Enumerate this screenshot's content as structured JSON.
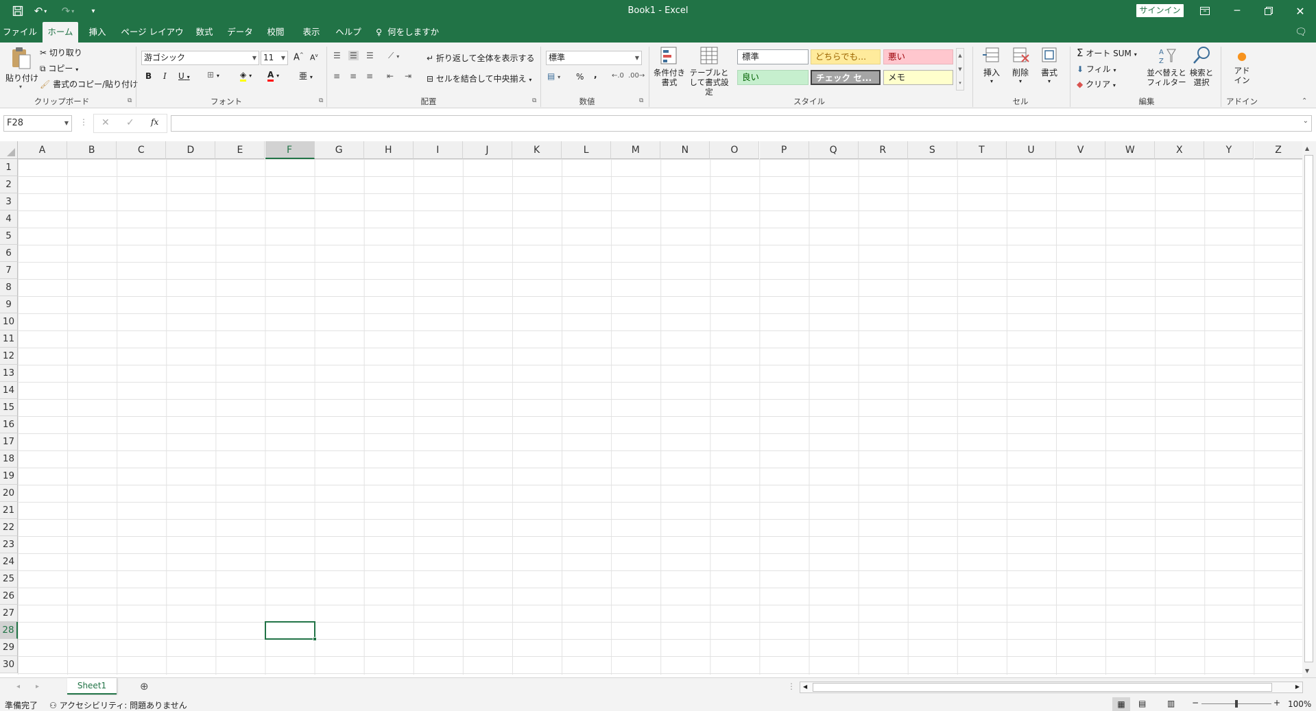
{
  "titlebar": {
    "title": "Book1 - Excel",
    "signin": "サインイン"
  },
  "tabs": [
    "ファイル",
    "ホーム",
    "挿入",
    "ページ レイアウト",
    "数式",
    "データ",
    "校閲",
    "表示",
    "ヘルプ"
  ],
  "tell_me": "何をしますか",
  "active_tab": "ホーム",
  "clipboard": {
    "paste": "貼り付け",
    "cut": "切り取り",
    "copy": "コピー",
    "format_painter": "書式のコピー/貼り付け",
    "label": "クリップボード"
  },
  "font": {
    "family": "游ゴシック",
    "size": "11",
    "bold": "B",
    "italic": "I",
    "underline": "U",
    "label": "フォント"
  },
  "alignment": {
    "wrap": "折り返して全体を表示する",
    "merge": "セルを結合して中央揃え",
    "label": "配置"
  },
  "number": {
    "format": "標準",
    "percent": "%",
    "comma": ",",
    "label": "数値"
  },
  "styles": {
    "conditional": "条件付き書式",
    "table": "テーブルとして書式設定",
    "label": "スタイル",
    "items": [
      {
        "name": "標準",
        "bg": "#ffffff",
        "fg": "#222222",
        "border": "#9aa0a6"
      },
      {
        "name": "どちらでも...",
        "bg": "#ffeb9c",
        "fg": "#9c6500",
        "border": "#e6d38a"
      },
      {
        "name": "悪い",
        "bg": "#ffc7ce",
        "fg": "#9c0006",
        "border": "#e8b4bb"
      },
      {
        "name": "良い",
        "bg": "#c6efce",
        "fg": "#006100",
        "border": "#b0d9b8"
      },
      {
        "name": "チェック セ...",
        "bg": "#a5a5a5",
        "fg": "#ffffff",
        "border": "#3f3f3f"
      },
      {
        "name": "メモ",
        "bg": "#ffffcc",
        "fg": "#222222",
        "border": "#b2b2b2"
      }
    ]
  },
  "cells": {
    "insert": "挿入",
    "delete": "削除",
    "format": "書式",
    "label": "セル"
  },
  "editing": {
    "autosum": "オート SUM",
    "fill": "フィル",
    "clear": "クリア",
    "sort": "並べ替えとフィルター",
    "find": "検索と選択",
    "label": "編集"
  },
  "addin": {
    "button": "アドイン",
    "label": "アドイン"
  },
  "formula_bar": {
    "namebox": "F28",
    "fx": "fx",
    "value": ""
  },
  "columns": [
    "A",
    "B",
    "C",
    "D",
    "E",
    "F",
    "G",
    "H",
    "I",
    "J",
    "K",
    "L",
    "M",
    "N",
    "O",
    "P",
    "Q",
    "R",
    "S",
    "T",
    "U",
    "V",
    "W",
    "X",
    "Y",
    "Z"
  ],
  "rows": [
    "1",
    "2",
    "3",
    "4",
    "5",
    "6",
    "7",
    "8",
    "9",
    "10",
    "11",
    "12",
    "13",
    "14",
    "15",
    "16",
    "17",
    "18",
    "19",
    "20",
    "21",
    "22",
    "23",
    "24",
    "25",
    "26",
    "27",
    "28",
    "29",
    "30"
  ],
  "selected_cell": {
    "col": "F",
    "row": "28"
  },
  "sheets": [
    "Sheet1"
  ],
  "status": {
    "ready": "準備完了",
    "accessibility": "アクセシビリティ: 問題ありません",
    "zoom": "100%"
  },
  "colors": {
    "brand": "#217346",
    "ribbon_bg": "#f3f3f3"
  }
}
